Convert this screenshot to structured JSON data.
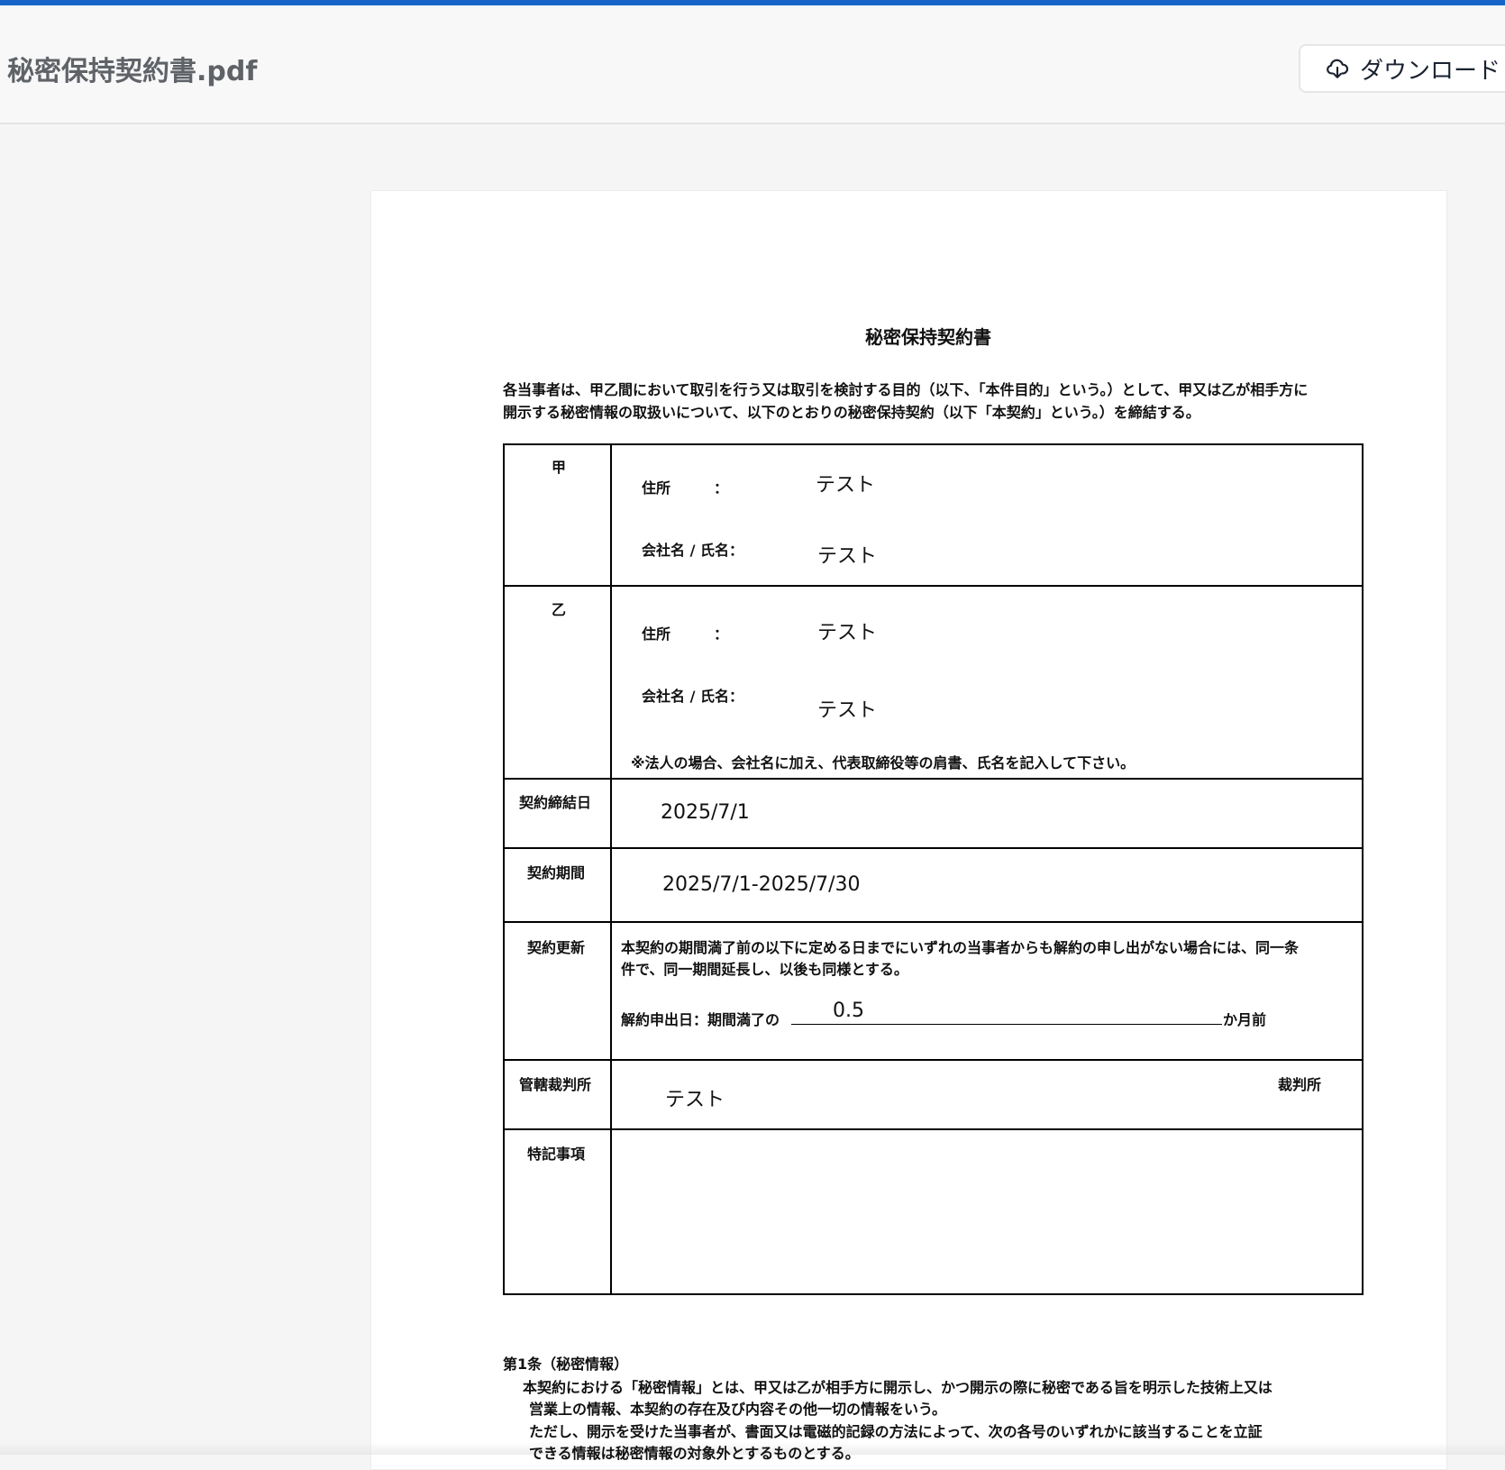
{
  "header": {
    "file_name": "秘密保持契約書.pdf",
    "download_label": "ダウンロード",
    "download_icon": "cloud-download-icon"
  },
  "doc": {
    "title": "秘密保持契約書",
    "intro": [
      "各当事者は、甲乙間において取引を行う又は取引を検討する目的（以下、「本件目的」という。）として、甲又は乙が相手方に",
      "開示する秘密情報の取扱いについて、以下のとおりの秘密保持契約（以下「本契約」という。）を締結する。"
    ],
    "party_a": {
      "label": "甲",
      "address_label": "住所　　　：",
      "address": "テスト",
      "name_label": "会社名 / 氏名：",
      "name": "テスト"
    },
    "party_b": {
      "label": "乙",
      "address_label": "住所　　　：",
      "address": "テスト",
      "name_label": "会社名 / 氏名：",
      "name": "テスト",
      "note": "※法人の場合、会社名に加え、代表取締役等の肩書、氏名を記入して下さい。"
    },
    "signing_date": {
      "label": "契約締結日",
      "value": "2025/7/1"
    },
    "period": {
      "label": "契約期間",
      "value": "2025/7/1-2025/7/30"
    },
    "renewal": {
      "label": "契約更新",
      "text": [
        "本契約の期間満了前の以下に定める日までにいずれの当事者からも解約の申し出がない場合には、同一条",
        "件で、同一期間延長し、以後も同様とする。"
      ],
      "notice_label": "解約申出日：期間満了の",
      "notice_value": "0.5",
      "notice_suffix": "か月前"
    },
    "court": {
      "label": "管轄裁判所",
      "value": "テスト",
      "suffix": "裁判所"
    },
    "special": {
      "label": "特記事項"
    },
    "article1": {
      "heading": "第1条（秘密情報）",
      "lines": [
        "本契約における「秘密情報」とは、甲又は乙が相手方に開示し、かつ開示の際に秘密である旨を明示した技術上又は",
        "営業上の情報、本契約の存在及び内容その他一切の情報をいう。",
        "ただし、開示を受けた当事者が、書面又は電磁的記録の方法によって、次の各号のいずれかに該当することを立証",
        "できる情報は秘密情報の対象外とするものとする。"
      ]
    }
  }
}
